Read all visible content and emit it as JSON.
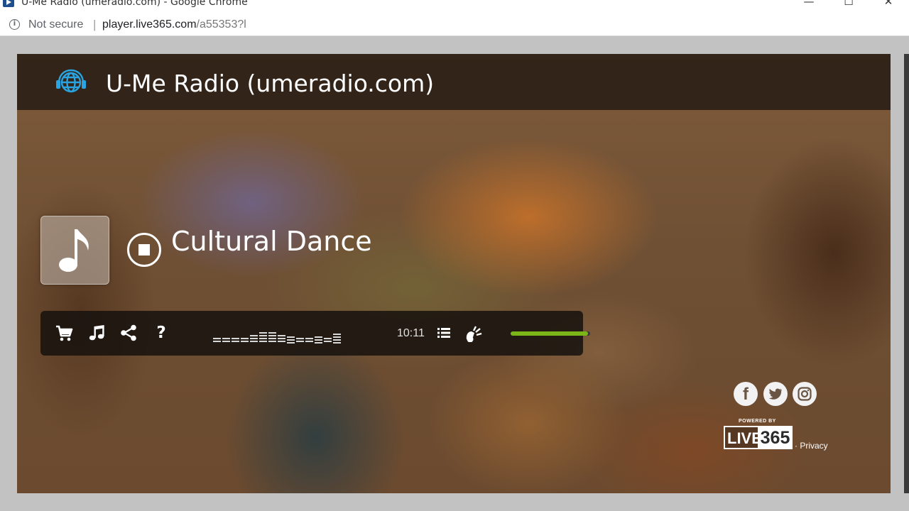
{
  "window": {
    "title": "U-Me Radio (umeradio.com) - Google Chrome",
    "minimize_glyph": "—",
    "maximize_glyph": "☐",
    "close_glyph": "✕"
  },
  "addressbar": {
    "info_glyph": "i",
    "security_label": "Not secure",
    "separator": "|",
    "url_host": "player.live365.com",
    "url_path": "/a55353?l"
  },
  "player": {
    "station_name": "U-Me Radio (umeradio.com)",
    "track_title": "Cultural Dance",
    "time": "10:11",
    "volume_level": 0.97,
    "help_glyph": "?",
    "icons": {
      "station": "globe-headphones-icon",
      "artwork": "music-note-icon",
      "stop": "stop-icon",
      "cart": "shopping-cart-icon",
      "music": "music-note-icon",
      "share": "share-icon",
      "help": "question-mark-icon",
      "playlist": "list-icon",
      "volume": "volume-icon"
    },
    "colors": {
      "accent": "#7cb518",
      "globe": "#2aa4e0"
    }
  },
  "footer": {
    "social": {
      "facebook_glyph": "f"
    },
    "powered_by": "POWERED BY",
    "brand_live": "LIVE",
    "brand_number": "365",
    "privacy_separator": "·",
    "privacy_label": "Privacy"
  }
}
